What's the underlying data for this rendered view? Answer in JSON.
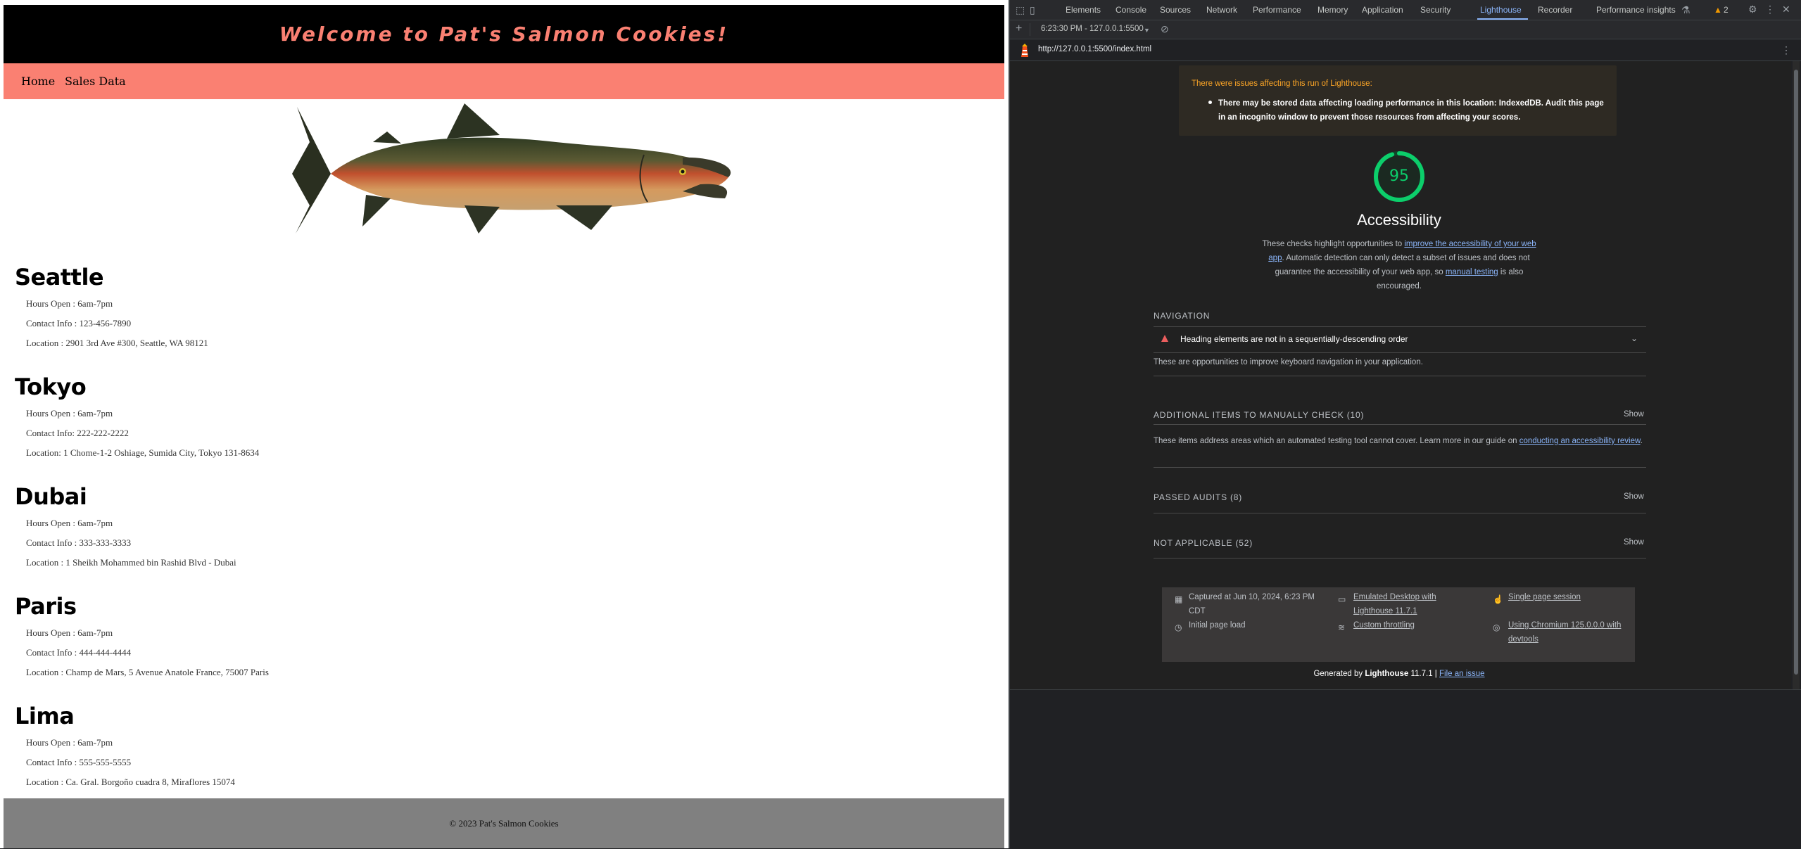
{
  "site": {
    "title": "Welcome to Pat's Salmon Cookies!",
    "nav": [
      "Home",
      "Sales Data"
    ],
    "locations": [
      {
        "name": "Seattle",
        "details": [
          "Hours Open : 6am-7pm",
          "Contact Info : 123-456-7890",
          "Location : 2901 3rd Ave #300, Seattle, WA 98121"
        ]
      },
      {
        "name": "Tokyo",
        "details": [
          "Hours Open : 6am-7pm",
          "Contact Info: 222-222-2222",
          "Location: 1 Chome-1-2 Oshiage, Sumida City, Tokyo 131-8634"
        ]
      },
      {
        "name": "Dubai",
        "details": [
          "Hours Open : 6am-7pm",
          "Contact Info : 333-333-3333",
          "Location : 1 Sheikh Mohammed bin Rashid Blvd - Dubai"
        ]
      },
      {
        "name": "Paris",
        "details": [
          "Hours Open : 6am-7pm",
          "Contact Info : 444-444-4444",
          "Location : Champ de Mars, 5 Avenue Anatole France, 75007 Paris"
        ]
      },
      {
        "name": "Lima",
        "details": [
          "Hours Open : 6am-7pm",
          "Contact Info : 555-555-5555",
          "Location : Ca. Gral. Borgoño cuadra 8, Miraflores 15074"
        ]
      }
    ],
    "footer": "© 2023 Pat's Salmon Cookies",
    "colors": {
      "header_bg": "#000000",
      "title": "#fa8072",
      "nav_bg": "#fa8072",
      "footer_bg": "#808080"
    }
  },
  "devtools": {
    "tabs": [
      "Elements",
      "Console",
      "Sources",
      "Network",
      "Performance",
      "Memory",
      "Application",
      "Security",
      "Lighthouse",
      "Recorder",
      "Performance insights"
    ],
    "active_tab": "Lighthouse",
    "issues_count": "2",
    "toolbar_session": "6:23:30 PM - 127.0.0.1:5500",
    "url": "http://127.0.0.1:5500/index.html",
    "warning": {
      "title": "There were issues affecting this run of Lighthouse:",
      "item": "There may be stored data affecting loading performance in this location: IndexedDB. Audit this page in an incognito window to prevent those resources from affecting your scores."
    },
    "score": "95",
    "score_fraction": 0.95,
    "category_title": "Accessibility",
    "description": {
      "part1": "These checks highlight opportunities to ",
      "link1": "improve the accessibility of your web app",
      "part2": ". Automatic detection can only detect a subset of issues and does not guarantee the accessibility of your web app, so ",
      "link2": "manual testing",
      "part3": " is also encouraged."
    },
    "navigation": {
      "title": "NAVIGATION",
      "audit": "Heading elements are not in a sequentially-descending order",
      "desc": "These are opportunities to improve keyboard navigation in your application."
    },
    "manual": {
      "title": "ADDITIONAL ITEMS TO MANUALLY CHECK (10)",
      "show": "Show",
      "desc_text": "These items address areas which an automated testing tool cannot cover. Learn more in our guide on ",
      "desc_link": "conducting an accessibility review",
      "desc_end": "."
    },
    "passed": {
      "title": "PASSED AUDITS (8)",
      "show": "Show"
    },
    "not_applicable": {
      "title": "NOT APPLICABLE (52)",
      "show": "Show"
    },
    "meta": {
      "captured": "Captured at Jun 10, 2024, 6:23 PM CDT",
      "initial": "Initial page load",
      "emulated": "Emulated Desktop with Lighthouse 11.7.1",
      "throttling": "Custom throttling",
      "session": "Single page session",
      "chromium": "Using Chromium 125.0.0.0 with devtools"
    },
    "footer": {
      "generated": "Generated by ",
      "brand": "Lighthouse",
      "version": " 11.7.1 | ",
      "issue": "File an issue"
    },
    "colors": {
      "score_green": "#0cce6b",
      "warning_orange": "#ffa726",
      "link_blue": "#8ab4f8",
      "fail_red": "#eb5e5e"
    }
  }
}
